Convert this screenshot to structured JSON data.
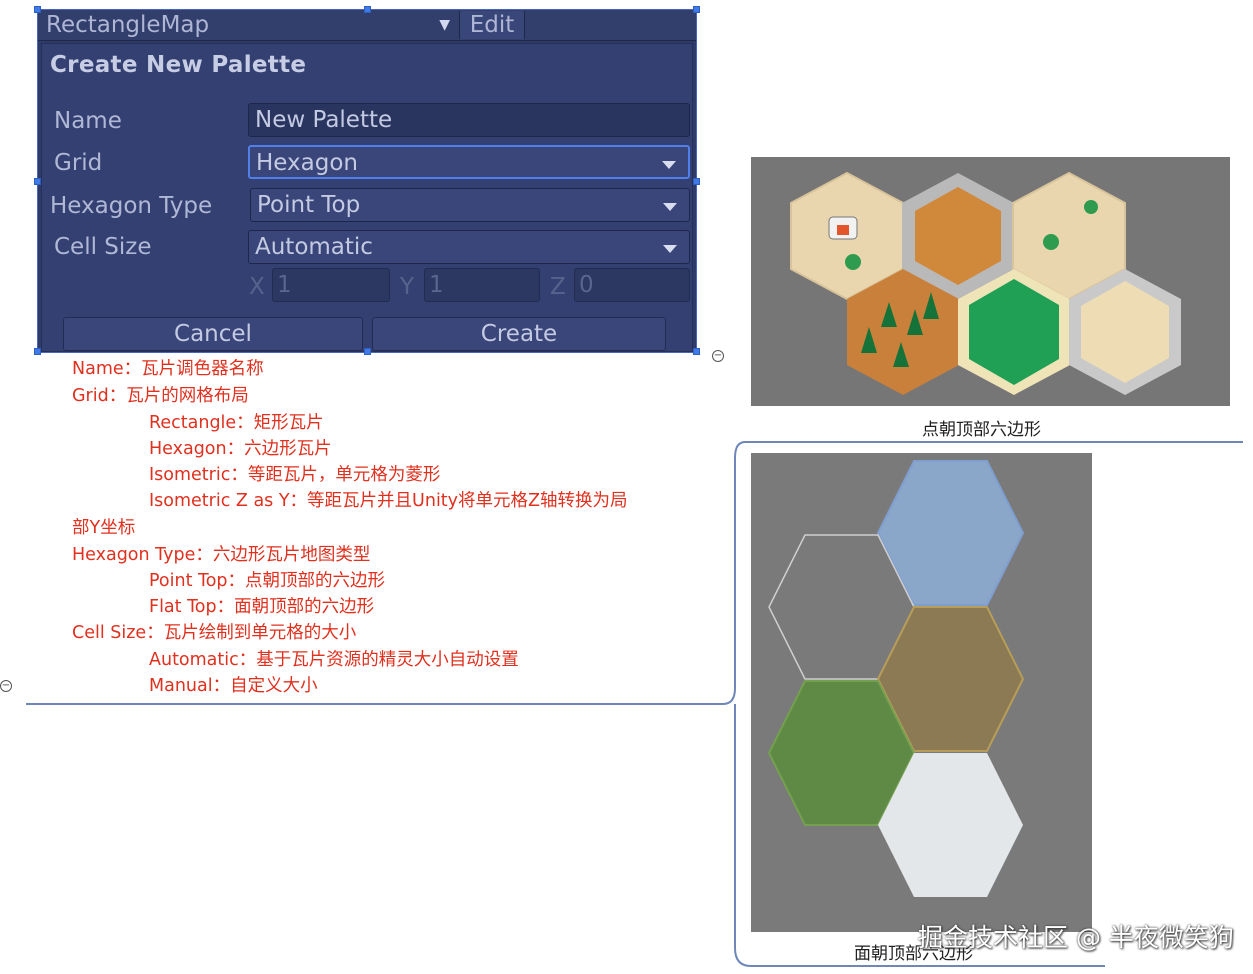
{
  "dialog": {
    "tilemap_name": "RectangleMap",
    "edit_label": "Edit",
    "title": "Create New Palette",
    "rows": {
      "name_label": "Name",
      "name_value": "New Palette",
      "grid_label": "Grid",
      "grid_value": "Hexagon",
      "hex_type_label": "Hexagon Type",
      "hex_type_value": "Point Top",
      "cell_size_label": "Cell Size",
      "cell_size_value": "Automatic"
    },
    "vector": {
      "x_label": "X",
      "x_value": "1",
      "y_label": "Y",
      "y_value": "1",
      "z_label": "Z",
      "z_value": "0"
    },
    "cancel_label": "Cancel",
    "create_label": "Create",
    "colors": {
      "background": "#2e3a67",
      "accent": "#4f7fe8"
    }
  },
  "notes": [
    "Name：瓦片调色器名称",
    "Grid：瓦片的网格布局",
    "Rectangle：矩形瓦片",
    "Hexagon：六边形瓦片",
    "Isometric：等距瓦片，单元格为菱形",
    "Isometric Z as Y：等距瓦片并且Unity将单元格Z轴转换为局",
    "部Y坐标",
    "Hexagon Type：六边形瓦片地图类型",
    "Point Top：点朝顶部的六边形",
    "Flat Top：面朝顶部的六边形",
    "Cell Size：瓦片绘制到单元格的大小",
    "Automatic：基于瓦片资源的精灵大小自动设置",
    "Manual：自定义大小"
  ],
  "collapse_symbol": "−",
  "images": {
    "point_top_caption": "点朝顶部六边形",
    "flat_top_caption": "面朝顶部六边形"
  },
  "watermark": "掘金技术社区 @ 半夜微笑狗",
  "icons": {
    "dropdown": "caret-down-icon",
    "collapse": "collapse-circle-icon"
  }
}
